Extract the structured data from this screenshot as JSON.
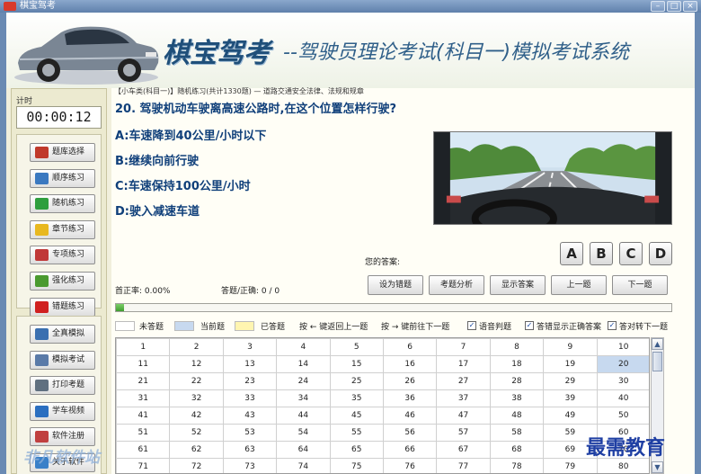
{
  "window": {
    "title": "棋宝驾考"
  },
  "banner": {
    "brand": "棋宝驾考",
    "subtitle": "--驾驶员理论考试(科目一)模拟考试系统"
  },
  "timer": {
    "label": "计时",
    "value": "00:00:12"
  },
  "nav_groups": [
    {
      "items": [
        {
          "label": "题库选择",
          "icon": "balls-icon"
        },
        {
          "label": "顺序练习",
          "icon": "edit-icon"
        },
        {
          "label": "随机练习",
          "icon": "shuffle-icon"
        },
        {
          "label": "章节练习",
          "icon": "note-icon"
        },
        {
          "label": "专项练习",
          "icon": "check-icon"
        },
        {
          "label": "强化练习",
          "icon": "bar-chart-icon"
        },
        {
          "label": "错题练习",
          "icon": "flag-icon"
        }
      ]
    },
    {
      "items": [
        {
          "label": "全真模拟",
          "icon": "window-icon"
        },
        {
          "label": "模拟考试",
          "icon": "calendar-icon"
        },
        {
          "label": "打印考题",
          "icon": "printer-icon"
        },
        {
          "label": "学车视频",
          "icon": "play-icon"
        },
        {
          "label": "软件注册",
          "icon": "key-icon"
        },
        {
          "label": "关于软件",
          "icon": "info-icon"
        }
      ]
    }
  ],
  "breadcrumb": "【小车类(科目一)】随机练习(共计1330题) — 道路交通安全法律、法规和规章",
  "question": {
    "text": "20. 驾驶机动车驶离高速公路时,在这个位置怎样行驶?",
    "options": [
      "A:车速降到40公里/小时以下",
      "B:继续向前行驶",
      "C:车速保持100公里/小时",
      "D:驶入减速车道"
    ]
  },
  "answer": {
    "label": "您的答案:",
    "buttons": [
      "A",
      "B",
      "C",
      "D"
    ]
  },
  "stats": {
    "accuracy": "首正率: 0.00%",
    "answered": "答题/正确: 0 / 0"
  },
  "actions": [
    {
      "label": "设为错题",
      "name": "mark-wrong-button"
    },
    {
      "label": "考题分析",
      "name": "analysis-button"
    },
    {
      "label": "显示答案",
      "name": "show-answer-button"
    },
    {
      "label": "上一题",
      "name": "prev-button"
    },
    {
      "label": "下一题",
      "name": "next-button"
    }
  ],
  "progress": {
    "value": 0.015
  },
  "legend": {
    "unanswered": "未答题",
    "current": "当前题",
    "answered": "已答题",
    "hint_prev": "按 ← 键返回上一题",
    "hint_next": "按 → 键前往下一题",
    "checks": [
      "语音判题",
      "答错显示正确答案",
      "答对转下一题"
    ]
  },
  "grid": {
    "rows": [
      [
        "1",
        "2",
        "3",
        "4",
        "5",
        "6",
        "7",
        "8",
        "9",
        "10"
      ],
      [
        "11",
        "12",
        "13",
        "14",
        "15",
        "16",
        "17",
        "18",
        "19",
        "20"
      ],
      [
        "21",
        "22",
        "23",
        "24",
        "25",
        "26",
        "27",
        "28",
        "29",
        "30"
      ],
      [
        "31",
        "32",
        "33",
        "34",
        "35",
        "36",
        "37",
        "38",
        "39",
        "40"
      ],
      [
        "41",
        "42",
        "43",
        "44",
        "45",
        "46",
        "47",
        "48",
        "49",
        "50"
      ],
      [
        "51",
        "52",
        "53",
        "54",
        "55",
        "56",
        "57",
        "58",
        "59",
        "60"
      ],
      [
        "61",
        "62",
        "63",
        "64",
        "65",
        "66",
        "67",
        "68",
        "69",
        "70"
      ],
      [
        "71",
        "72",
        "73",
        "74",
        "75",
        "76",
        "77",
        "78",
        "79",
        "80"
      ]
    ],
    "current": "20"
  },
  "watermarks": {
    "left": "非凡软件站",
    "right": "最需教育"
  },
  "colors": {
    "brand": "#1f4f7a",
    "question": "#0f3f7a",
    "current": "#c7d9ef",
    "answered_swatch": "#fff5b0"
  }
}
